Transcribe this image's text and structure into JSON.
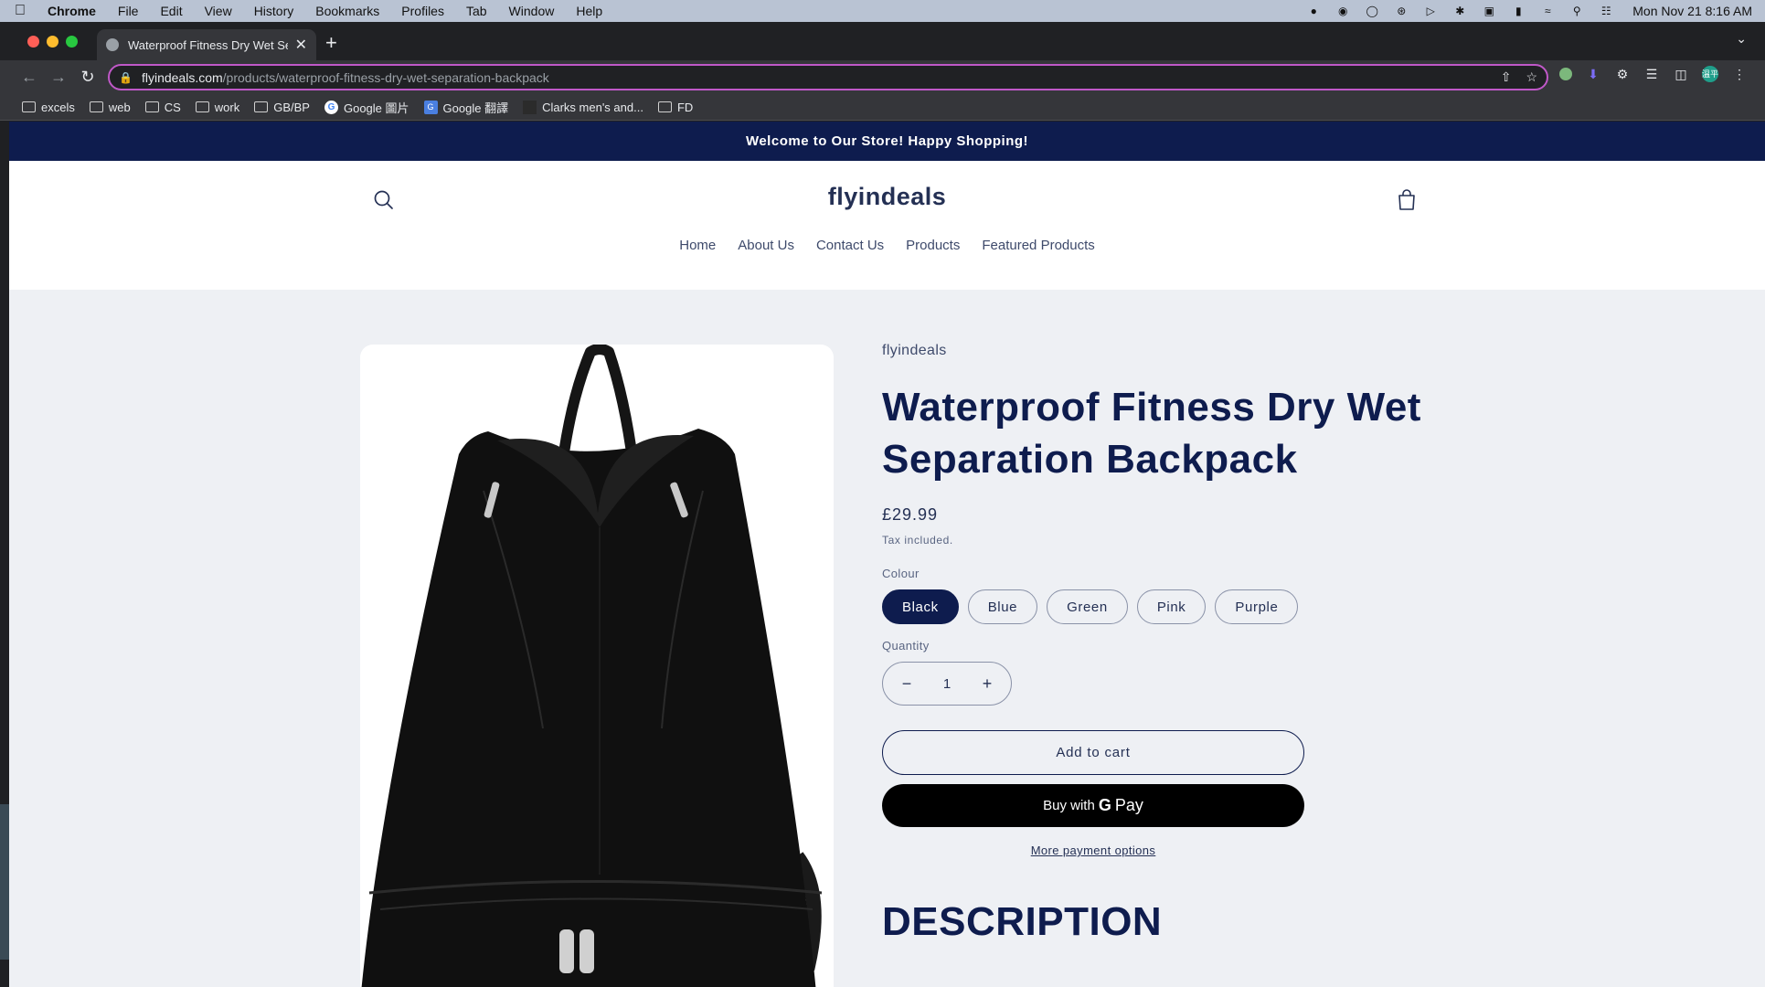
{
  "menubar": {
    "app": "Chrome",
    "items": [
      "File",
      "Edit",
      "View",
      "History",
      "Bookmarks",
      "Profiles",
      "Tab",
      "Window",
      "Help"
    ],
    "clock": "Mon Nov 21  8:16 AM"
  },
  "browser": {
    "tab_title": "Waterproof Fitness Dry Wet Se",
    "url_host": "flyindeals.com",
    "url_path": "/products/waterproof-fitness-dry-wet-separation-backpack",
    "profile_badge": "溫平"
  },
  "bookmarks": [
    {
      "label": "excels",
      "icon": "folder-icon"
    },
    {
      "label": "web",
      "icon": "folder-icon"
    },
    {
      "label": "CS",
      "icon": "folder-icon"
    },
    {
      "label": "work",
      "icon": "folder-icon"
    },
    {
      "label": "GB/BP",
      "icon": "folder-icon"
    },
    {
      "label": "Google 圖片",
      "icon": "google-icon"
    },
    {
      "label": "Google 翻譯",
      "icon": "translate-icon"
    },
    {
      "label": "Clarks men's and...",
      "icon": "clarks-icon"
    },
    {
      "label": "FD",
      "icon": "folder-icon"
    }
  ],
  "store": {
    "announcement": "Welcome to Our Store! Happy Shopping!",
    "logo": "flyindeals",
    "nav": [
      "Home",
      "About Us",
      "Contact Us",
      "Products",
      "Featured Products"
    ]
  },
  "product": {
    "vendor": "flyindeals",
    "title": "Waterproof Fitness Dry Wet Separation Backpack",
    "price": "£29.99",
    "tax_note": "Tax included.",
    "colour_label": "Colour",
    "colours": [
      "Black",
      "Blue",
      "Green",
      "Pink",
      "Purple"
    ],
    "selected_colour": "Black",
    "quantity_label": "Quantity",
    "quantity": "1",
    "add_to_cart": "Add to cart",
    "buy_with": "Buy with",
    "pay_label": "Pay",
    "more_payment": "More payment options",
    "description_heading": "DESCRIPTION"
  }
}
